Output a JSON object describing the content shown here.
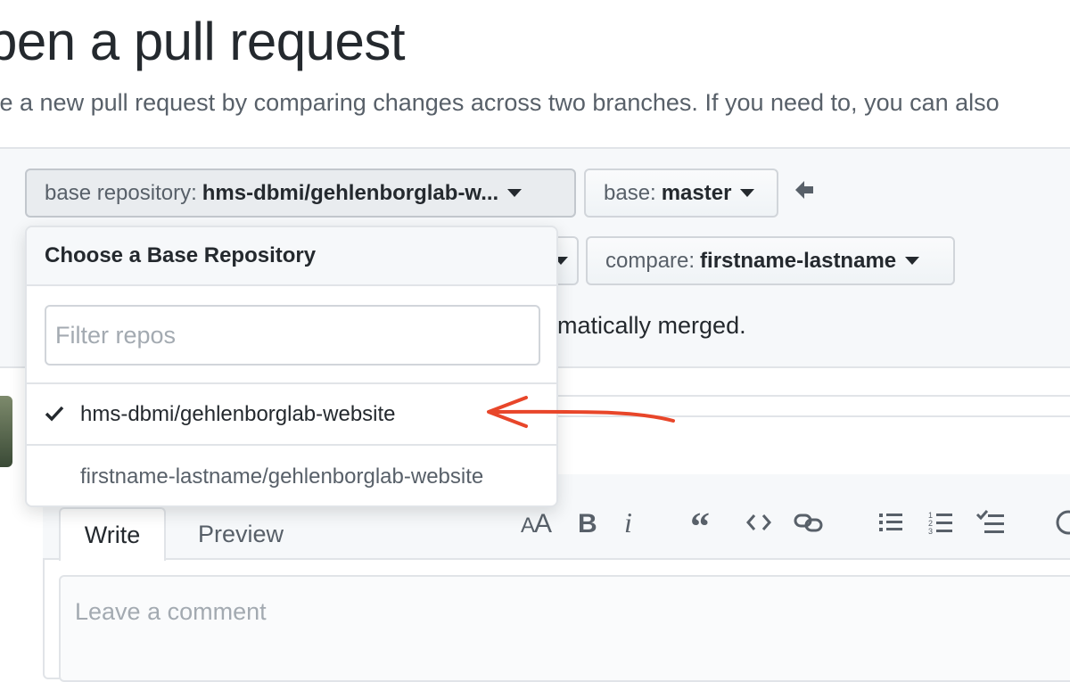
{
  "header": {
    "title": "pen a pull request",
    "subtitle": "te a new pull request by comparing changes across two branches. If you need to, you can also"
  },
  "compare": {
    "base_repo_label": "base repository: ",
    "base_repo_value": "hms-dbmi/gehlenborglab-w...",
    "base_branch_label": "base: ",
    "base_branch_value": "master",
    "compare_label": "compare: ",
    "compare_value": "firstname-lastname",
    "merge_status": "omatically merged."
  },
  "dropdown": {
    "title": "Choose a Base Repository",
    "filter_placeholder": "Filter repos",
    "items": [
      {
        "label": "hms-dbmi/gehlenborglab-website",
        "selected": true
      },
      {
        "label": "firstname-lastname/gehlenborglab-website",
        "selected": false
      }
    ]
  },
  "editor": {
    "tabs": [
      "Write",
      "Preview"
    ],
    "toolbar_icons": [
      "text-size-icon",
      "bold-icon",
      "italic-icon",
      "quote-icon",
      "code-icon",
      "link-icon",
      "unordered-list-icon",
      "ordered-list-icon",
      "task-list-icon",
      "mention-icon"
    ],
    "comment_placeholder": "Leave a comment"
  },
  "colors": {
    "annotation_arrow": "#e8462a",
    "panel_bg": "#f6f8fa",
    "border": "#e1e4e8"
  }
}
